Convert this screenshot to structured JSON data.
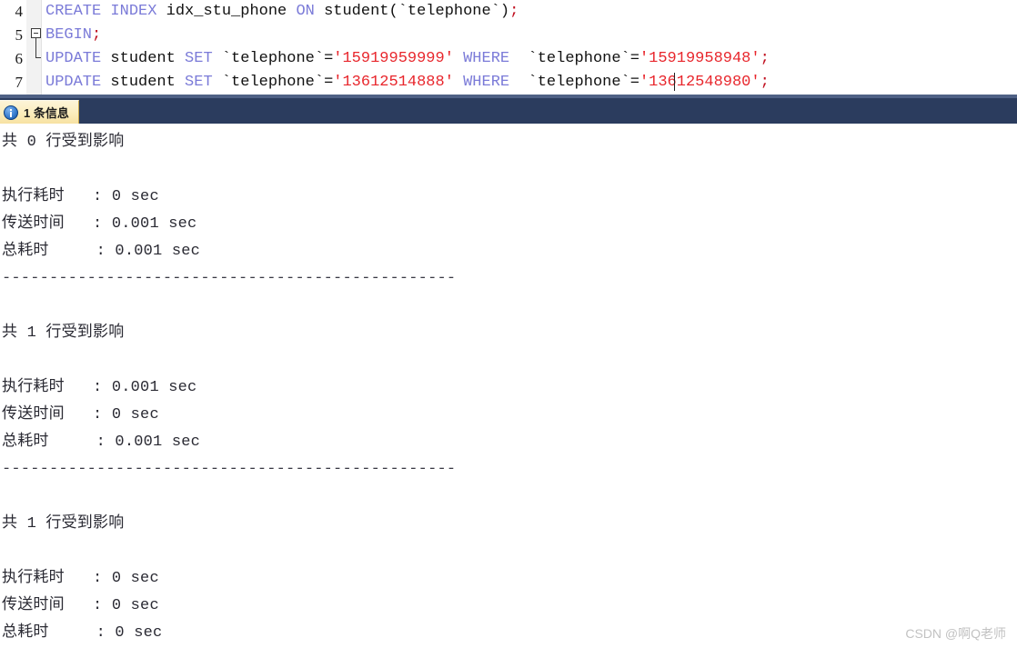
{
  "editor": {
    "line_numbers": [
      "4",
      "5",
      "6",
      "7"
    ],
    "fold_marker": "collapse-minus",
    "lines": [
      {
        "number": "4",
        "tokens": [
          {
            "t": "CREATE",
            "c": "kw"
          },
          {
            "t": " ",
            "c": "pun"
          },
          {
            "t": "INDEX",
            "c": "kw"
          },
          {
            "t": " idx_stu_phone ",
            "c": "ident"
          },
          {
            "t": "ON",
            "c": "kw"
          },
          {
            "t": " student(`telephone`)",
            "c": "ident"
          },
          {
            "t": ";",
            "c": "semi"
          }
        ]
      },
      {
        "number": "5",
        "tokens": [
          {
            "t": "BEGIN",
            "c": "kw"
          },
          {
            "t": ";",
            "c": "semi"
          }
        ]
      },
      {
        "number": "6",
        "tokens": [
          {
            "t": "UPDATE",
            "c": "kw"
          },
          {
            "t": " student ",
            "c": "ident"
          },
          {
            "t": "SET",
            "c": "kw"
          },
          {
            "t": " `telephone`=",
            "c": "ident"
          },
          {
            "t": "'15919959999'",
            "c": "str"
          },
          {
            "t": " ",
            "c": "ident"
          },
          {
            "t": "WHERE",
            "c": "kw"
          },
          {
            "t": "  `telephone`=",
            "c": "ident"
          },
          {
            "t": "'15919958948'",
            "c": "str"
          },
          {
            "t": ";",
            "c": "semi"
          }
        ]
      },
      {
        "number": "7",
        "tokens": [
          {
            "t": "UPDATE",
            "c": "kw"
          },
          {
            "t": " student ",
            "c": "ident"
          },
          {
            "t": "SET",
            "c": "kw"
          },
          {
            "t": " `telephone`=",
            "c": "ident"
          },
          {
            "t": "'13612514888'",
            "c": "str"
          },
          {
            "t": " ",
            "c": "ident"
          },
          {
            "t": "WHERE",
            "c": "kw"
          },
          {
            "t": "  `telephone`=",
            "c": "ident"
          },
          {
            "t": "'13612548980'",
            "c": "str"
          },
          {
            "t": ";",
            "c": "semi"
          }
        ]
      }
    ]
  },
  "info_tab": {
    "icon": "info-circle-icon",
    "label": "1 条信息"
  },
  "result": {
    "separator": "------------------------------------------------",
    "blocks": [
      {
        "affected": "共 0 行受到影响",
        "rows": [
          {
            "label": "执行耗时",
            "value": ": 0 sec"
          },
          {
            "label": "传送时间",
            "value": ": 0.001 sec"
          },
          {
            "label": "总耗时",
            "value": ": 0.001 sec"
          }
        ]
      },
      {
        "affected": "共 1 行受到影响",
        "rows": [
          {
            "label": "执行耗时",
            "value": ": 0.001 sec"
          },
          {
            "label": "传送时间",
            "value": ": 0 sec"
          },
          {
            "label": "总耗时",
            "value": ": 0.001 sec"
          }
        ]
      },
      {
        "affected": "共 1 行受到影响",
        "rows": [
          {
            "label": "执行耗时",
            "value": ": 0 sec"
          },
          {
            "label": "传送时间",
            "value": ": 0 sec"
          },
          {
            "label": "总耗时",
            "value": ": 0 sec"
          }
        ]
      }
    ]
  },
  "watermark": {
    "text": "CSDN @啊Q老师"
  },
  "colors": {
    "keyword": "#7b7bd8",
    "string": "#e8262c",
    "identifier": "#111111",
    "tab_background": "#fbeec0",
    "splitter_dark": "#2b3c5e",
    "splitter_light": "#4f6185",
    "result_text": "#2a2a33"
  }
}
